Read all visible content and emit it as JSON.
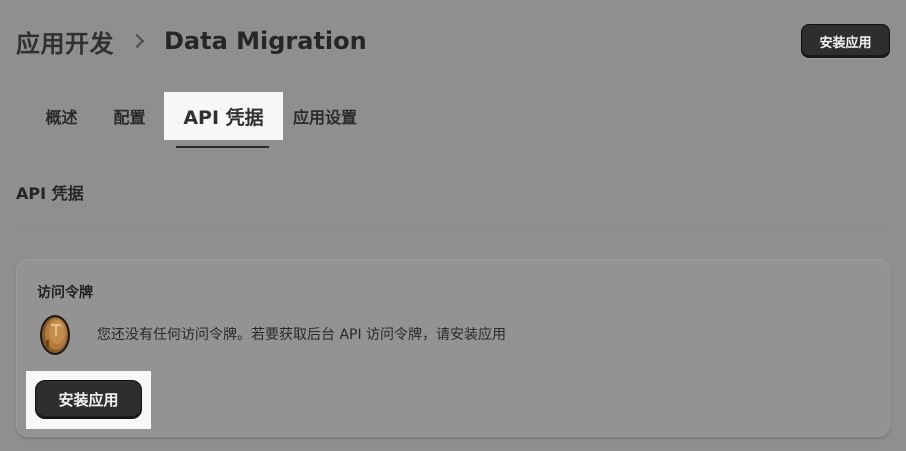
{
  "breadcrumb": {
    "root": "应用开发",
    "current": "Data Migration"
  },
  "header": {
    "install_label": "安装应用"
  },
  "tabs": [
    {
      "label": "概述"
    },
    {
      "label": "配置"
    },
    {
      "label": "API 凭据",
      "active": true
    },
    {
      "label": "应用设置"
    }
  ],
  "section": {
    "title": "API 凭据"
  },
  "card": {
    "title": "访问令牌",
    "icon": "token-coin-icon",
    "message": "您还没有任何访问令牌。若要获取后台 API 访问令牌，请安装应用",
    "install_label": "安装应用"
  },
  "colors": {
    "page_bg": "#8f8f8f",
    "button_dark": "#2e2e2e",
    "highlight": "#f7f7f7",
    "coin": "#b07a3a"
  }
}
